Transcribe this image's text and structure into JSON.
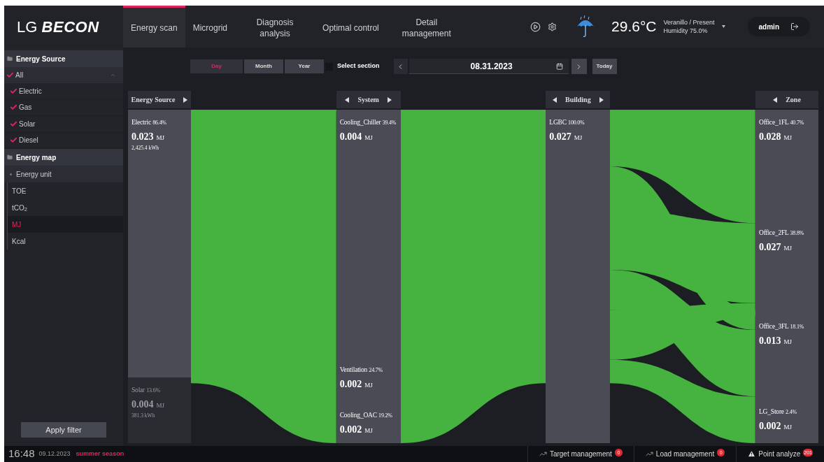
{
  "header": {
    "logo": {
      "prefix": "LG",
      "name": "BECON"
    },
    "tabs": [
      {
        "label": "Energy scan",
        "selected": true
      },
      {
        "label": "Microgrid",
        "selected": false
      },
      {
        "label": "Diagnosis analysis",
        "selected": false
      },
      {
        "label": "Optimal control",
        "selected": false
      },
      {
        "label": "Detail management",
        "selected": false
      }
    ],
    "weather": {
      "temperature": "29.6°C",
      "location": "Veranillo / Present",
      "humidity": "Humidity 75.0%"
    },
    "user": "admin"
  },
  "sidebar": {
    "energy_source": {
      "title": "Energy Source",
      "all": {
        "label": "All",
        "checked": true,
        "expanded": true
      },
      "items": [
        {
          "label": "Electric",
          "checked": true
        },
        {
          "label": "Gas",
          "checked": true
        },
        {
          "label": "Solar",
          "checked": true
        },
        {
          "label": "Diesel",
          "checked": true
        }
      ]
    },
    "energy_map": {
      "title": "Energy map",
      "group": "Energy unit",
      "units": [
        {
          "label": "TOE",
          "selected": false
        },
        {
          "label": "tCO$_{2}$",
          "selected": false
        },
        {
          "label": "MJ",
          "selected": true
        },
        {
          "label": "Kcal",
          "selected": false
        }
      ]
    },
    "apply_button": "Apply filter"
  },
  "toolbar": {
    "periods": [
      {
        "label": "Day",
        "selected": true
      },
      {
        "label": "Month",
        "selected": false
      },
      {
        "label": "Year",
        "selected": false
      }
    ],
    "select_section": {
      "label": "Select section",
      "checked": false
    },
    "date": "08.31.2023",
    "today_button": "Today"
  },
  "sankey": {
    "columns": [
      {
        "header": "Energy Source",
        "has_prev": false,
        "has_next": true,
        "nodes": [
          {
            "name": "Electric",
            "share": "86.4%",
            "value": "0.023",
            "unit": "MJ",
            "sub": "2,425.4 kWh",
            "dimmed": false
          },
          {
            "name": "Solar",
            "share": "13.6%",
            "value": "0.004",
            "unit": "MJ",
            "sub": "381.3 kWh",
            "dimmed": true
          }
        ]
      },
      {
        "header": "System",
        "has_prev": true,
        "has_next": true,
        "nodes": [
          {
            "name": "Cooling_Chiller",
            "share": "39.4%",
            "value": "0.004",
            "unit": "MJ",
            "dimmed": false
          },
          {
            "name": "Ventilation",
            "share": "24.7%",
            "value": "0.002",
            "unit": "MJ",
            "dimmed": false
          },
          {
            "name": "Cooling_OAC",
            "share": "19.2%",
            "value": "0.002",
            "unit": "MJ",
            "dimmed": false
          }
        ]
      },
      {
        "header": "Building",
        "has_prev": true,
        "has_next": true,
        "nodes": [
          {
            "name": "LGBC",
            "share": "100.0%",
            "value": "0.027",
            "unit": "MJ",
            "dimmed": false
          }
        ]
      },
      {
        "header": "Zone",
        "has_prev": true,
        "has_next": false,
        "nodes": [
          {
            "name": "Office_1FL",
            "share": "40.7%",
            "value": "0.028",
            "unit": "MJ",
            "dimmed": false
          },
          {
            "name": "Office_2FL",
            "share": "38.8%",
            "value": "0.027",
            "unit": "MJ",
            "dimmed": false
          },
          {
            "name": "Office_3FL",
            "share": "18.1%",
            "value": "0.013",
            "unit": "MJ",
            "dimmed": false
          },
          {
            "name": "LG_Store",
            "share": "2.4%",
            "value": "0.002",
            "unit": "MJ",
            "dimmed": false
          }
        ]
      }
    ]
  },
  "status_bar": {
    "time": "16:48",
    "date": "09.12.2023",
    "season": "summer season",
    "alerts": [
      {
        "kind": "trend",
        "label": "Target management",
        "count": "0"
      },
      {
        "kind": "trend",
        "label": "Load management",
        "count": "0"
      },
      {
        "kind": "warning",
        "label": "Point analyze",
        "count": "201"
      }
    ]
  }
}
